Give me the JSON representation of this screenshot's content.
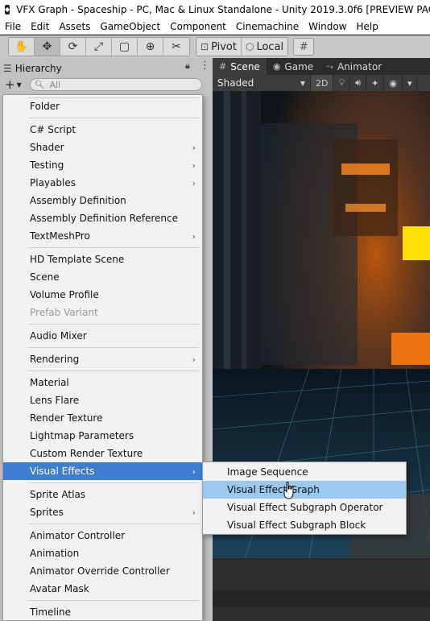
{
  "window": {
    "title": "VFX Graph - Spaceship - PC, Mac & Linux Standalone - Unity 2019.3.0f6 [PREVIEW PACKAGES IN U",
    "app_icon": "unity-icon"
  },
  "menubar": {
    "items": [
      "File",
      "Edit",
      "Assets",
      "GameObject",
      "Component",
      "Cinemachine",
      "Window",
      "Help"
    ]
  },
  "toolbar": {
    "tools": [
      {
        "name": "hand-tool",
        "glyph": "✋"
      },
      {
        "name": "move-tool",
        "glyph": "✥"
      },
      {
        "name": "rotate-tool",
        "glyph": "⟳"
      },
      {
        "name": "scale-tool",
        "glyph": "⤢"
      },
      {
        "name": "rect-tool",
        "glyph": "▢"
      },
      {
        "name": "transform-tool",
        "glyph": "⊕"
      },
      {
        "name": "custom-tool",
        "glyph": "✂"
      }
    ],
    "pivot_label": "Pivot",
    "local_label": "Local"
  },
  "hierarchy": {
    "tab_label": "Hierarchy",
    "add_glyph": "+",
    "search_placeholder": "All"
  },
  "scene": {
    "tabs": [
      {
        "label": "Scene",
        "icon": "grid-icon",
        "glyph": "#"
      },
      {
        "label": "Game",
        "icon": "gamepad-icon",
        "glyph": "◉"
      },
      {
        "label": "Animator",
        "icon": "animator-icon",
        "glyph": "⤳"
      }
    ],
    "shading_mode": "Shaded",
    "mode_2d": "2D"
  },
  "context_menu": {
    "groups": [
      [
        {
          "label": "Folder"
        }
      ],
      [
        {
          "label": "C# Script"
        },
        {
          "label": "Shader",
          "submenu": true
        },
        {
          "label": "Testing",
          "submenu": true
        },
        {
          "label": "Playables",
          "submenu": true
        },
        {
          "label": "Assembly Definition"
        },
        {
          "label": "Assembly Definition Reference"
        },
        {
          "label": "TextMeshPro",
          "submenu": true
        }
      ],
      [
        {
          "label": "HD Template Scene"
        },
        {
          "label": "Scene"
        },
        {
          "label": "Volume Profile"
        },
        {
          "label": "Prefab Variant",
          "disabled": true
        }
      ],
      [
        {
          "label": "Audio Mixer"
        }
      ],
      [
        {
          "label": "Rendering",
          "submenu": true
        }
      ],
      [
        {
          "label": "Material"
        },
        {
          "label": "Lens Flare"
        },
        {
          "label": "Render Texture"
        },
        {
          "label": "Lightmap Parameters"
        },
        {
          "label": "Custom Render Texture"
        },
        {
          "label": "Visual Effects",
          "submenu": true,
          "highlight": true
        }
      ],
      [
        {
          "label": "Sprite Atlas"
        },
        {
          "label": "Sprites",
          "submenu": true
        }
      ],
      [
        {
          "label": "Animator Controller"
        },
        {
          "label": "Animation"
        },
        {
          "label": "Animator Override Controller"
        },
        {
          "label": "Avatar Mask"
        }
      ],
      [
        {
          "label": "Timeline"
        }
      ]
    ]
  },
  "submenu": {
    "items": [
      {
        "label": "Image Sequence"
      },
      {
        "label": "Visual Effect Graph",
        "highlight": true
      },
      {
        "label": "Visual Effect Subgraph Operator"
      },
      {
        "label": "Visual Effect Subgraph Block"
      }
    ]
  },
  "colors": {
    "menu_highlight": "#3f7dd0",
    "submenu_highlight": "#99c9ef",
    "scene_glow": "#ffe000"
  }
}
